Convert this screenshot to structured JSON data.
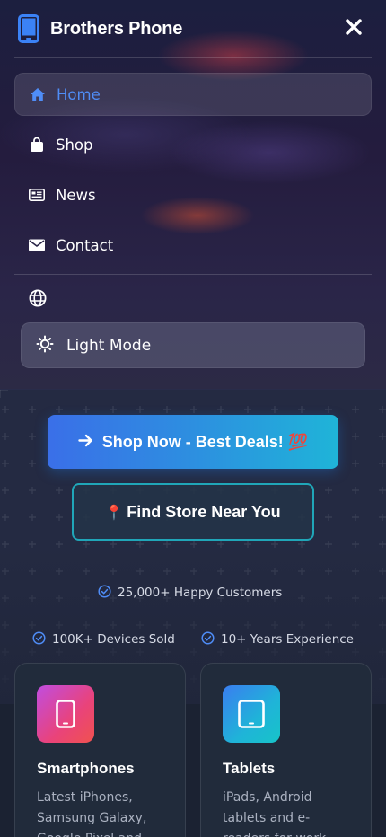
{
  "header": {
    "brand_name": "Brothers Phone",
    "brand_icon": "smartphone-icon",
    "close_icon": "close-icon"
  },
  "nav": {
    "items": [
      {
        "label": "Home",
        "icon": "home-icon",
        "active": true
      },
      {
        "label": "Shop",
        "icon": "shopping-bag-icon",
        "active": false
      },
      {
        "label": "News",
        "icon": "newspaper-icon",
        "active": false
      },
      {
        "label": "Contact",
        "icon": "envelope-icon",
        "active": false
      }
    ],
    "language_icon": "globe-icon",
    "theme_toggle": {
      "label": "Light Mode",
      "icon": "sun-icon"
    }
  },
  "hero": {
    "shop_button": {
      "label": "Shop Now - Best Deals! 💯",
      "icon": "arrow-right-icon"
    },
    "store_button": {
      "label": "Find Store Near You",
      "icon": "📍"
    },
    "stats": [
      {
        "text": "25,000+ Happy Customers"
      },
      {
        "text": "100K+ Devices Sold"
      },
      {
        "text": "10+ Years Experience"
      }
    ]
  },
  "categories": [
    {
      "title": "Smartphones",
      "description": "Latest iPhones, Samsung Galaxy, Google Pixel and",
      "icon": "smartphone-icon"
    },
    {
      "title": "Tablets",
      "description": "iPads, Android tablets and e-readers for work",
      "icon": "tablet-icon"
    }
  ],
  "colors": {
    "accent": "#4f8df7",
    "teal": "#20a6b8",
    "background": "#1b2232"
  }
}
